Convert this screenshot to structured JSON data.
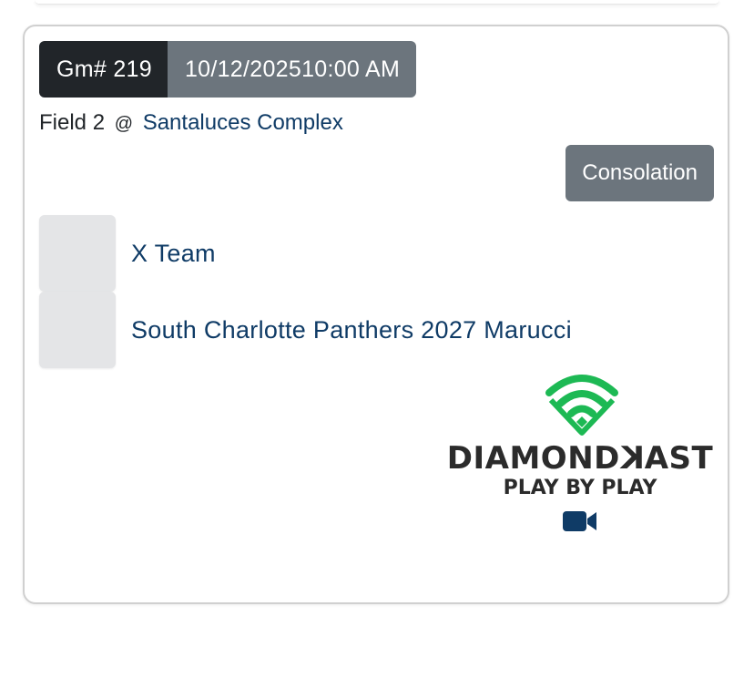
{
  "game": {
    "number_label": "Gm# 219",
    "date": "10/12/2025",
    "time": "10:00 AM"
  },
  "location": {
    "field": "Field 2",
    "at": "@",
    "venue": "Santaluces Complex"
  },
  "bracket_label": "Consolation",
  "teams": [
    {
      "name": "X Team"
    },
    {
      "name": "South Charlotte Panthers 2027 Marucci"
    }
  ],
  "stream": {
    "brand_prefix": "DIAMOND",
    "brand_k": "K",
    "brand_suffix": "AST",
    "tagline": "PLAY BY PLAY",
    "icon": "video-camera-icon"
  },
  "colors": {
    "dark_badge": "#212529",
    "grey_badge": "#6c757d",
    "link_blue": "#0f3b66",
    "brand_green": "#1db954",
    "logo_placeholder": "#e4e5e7"
  }
}
